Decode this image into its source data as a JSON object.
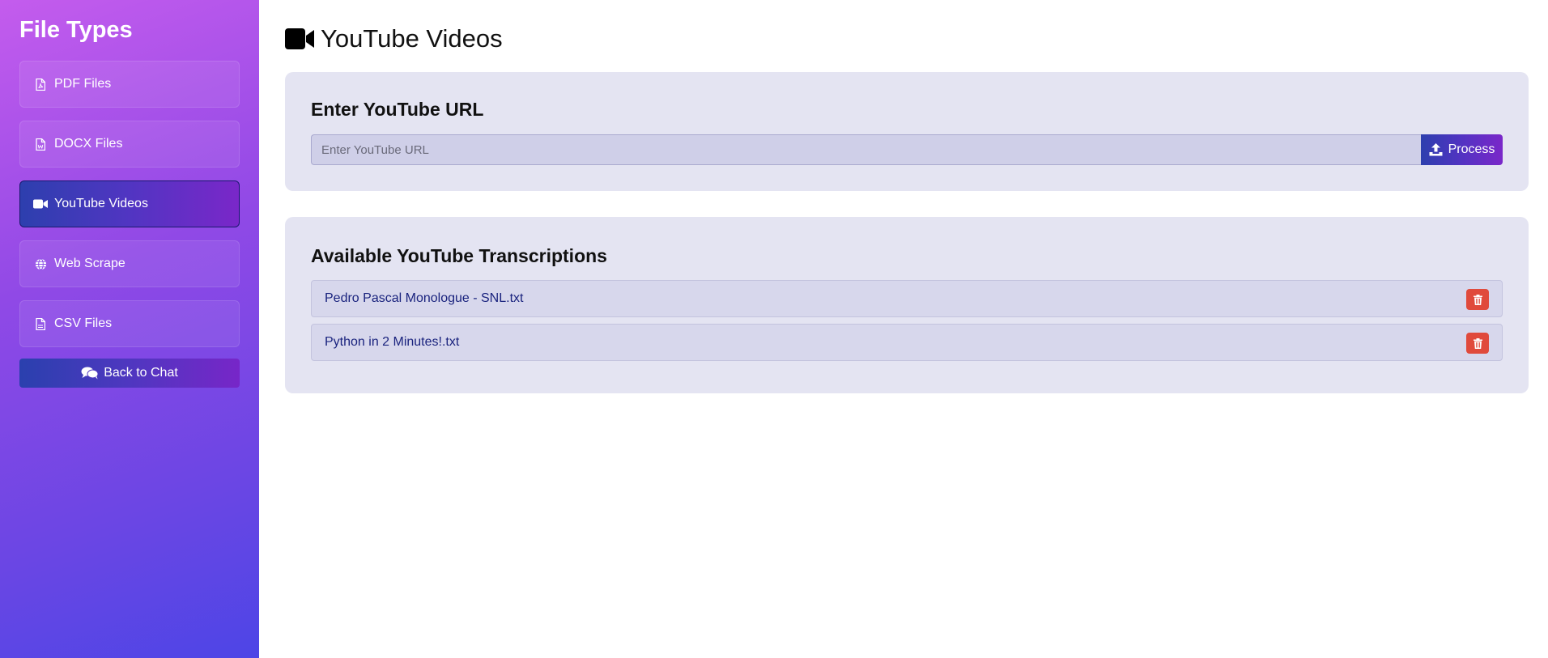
{
  "sidebar": {
    "title": "File Types",
    "items": [
      {
        "label": "PDF Files",
        "icon": "pdf-file-icon",
        "active": false
      },
      {
        "label": "DOCX Files",
        "icon": "word-file-icon",
        "active": false
      },
      {
        "label": "YouTube Videos",
        "icon": "video-camera-icon",
        "active": true
      },
      {
        "label": "Web Scrape",
        "icon": "globe-icon",
        "active": false
      },
      {
        "label": "CSV Files",
        "icon": "csv-file-icon",
        "active": false
      }
    ],
    "back_button": {
      "label": "Back to Chat",
      "icon": "comments-icon"
    }
  },
  "main": {
    "title": "YouTube Videos",
    "title_icon": "video-camera-icon",
    "url_card": {
      "heading": "Enter YouTube URL",
      "input_placeholder": "Enter YouTube URL",
      "input_value": "",
      "process_label": "Process",
      "process_icon": "upload-icon"
    },
    "transcriptions_card": {
      "heading": "Available YouTube Transcriptions",
      "items": [
        {
          "name": "Pedro Pascal Monologue - SNL.txt"
        },
        {
          "name": "Python in 2 Minutes!.txt"
        }
      ]
    }
  },
  "colors": {
    "accent_gradient_start": "#2d3fae",
    "accent_gradient_end": "#7a27c9",
    "card_bg": "#e4e4f2",
    "delete": "#e04a3c",
    "link_text": "#1a237e"
  }
}
